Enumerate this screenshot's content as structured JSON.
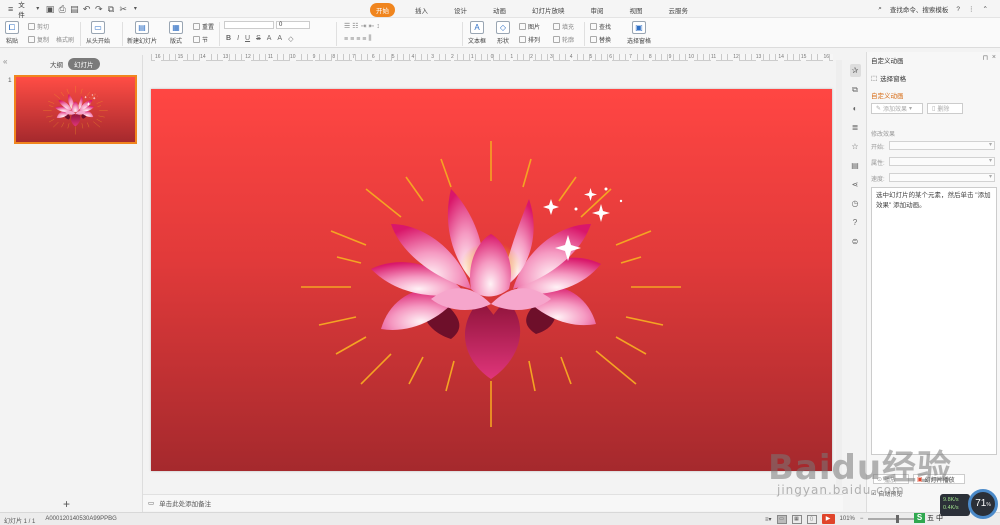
{
  "topbar": {
    "file_menu": "文件",
    "tabs": [
      "开始",
      "插入",
      "设计",
      "动画",
      "幻灯片放映",
      "审阅",
      "视图",
      "云服务"
    ],
    "active_tab": "开始",
    "search_text": "查找命令、搜索模板"
  },
  "ribbon": {
    "paste": "粘贴",
    "cut": "剪切",
    "copy": "复制",
    "format_painter": "格式刷",
    "from_start": "从头开始",
    "new_slide": "新建幻灯片",
    "layout": "版式",
    "reset": "重置",
    "section": "节",
    "font_size": "0",
    "text_box": "文本框",
    "shape": "形状",
    "picture": "图片",
    "fill": "填充",
    "arrange": "排列",
    "outline": "轮廓",
    "find": "查找",
    "replace": "替换",
    "select_pane": "选择窗格"
  },
  "left_panel": {
    "tab_outline": "大纲",
    "tab_slides": "幻灯片",
    "slide_number": "1",
    "add_icon": "+"
  },
  "ruler_ticks": [
    "16",
    "15",
    "14",
    "13",
    "12",
    "11",
    "10",
    "9",
    "8",
    "7",
    "6",
    "5",
    "4",
    "3",
    "2",
    "1",
    "0",
    "1",
    "2",
    "3",
    "4",
    "5",
    "6",
    "7",
    "8",
    "9",
    "10",
    "11",
    "12",
    "13",
    "14",
    "15",
    "16"
  ],
  "notes": {
    "placeholder": "单击此处添加备注"
  },
  "pane": {
    "title": "自定义动画",
    "select_pane": "选择窗格",
    "subtitle": "自定义动画",
    "add_effect": "添加效果",
    "delete": "删除",
    "modify_effect": "修改效果",
    "start_label": "开始:",
    "property_label": "属性:",
    "speed_label": "速度:",
    "hint": "选中幻灯片的某个元素，然后单击 \"添加效果\" 添加动画。",
    "play": "播放",
    "slideshow": "幻灯片播放",
    "autopreview": "自动预览"
  },
  "status": {
    "slide_info": "幻灯片 1 / 1",
    "doc_id": "A000120140530A99PPBG",
    "zoom": "101%"
  },
  "overlay": {
    "gauge_value": "71",
    "gauge_unit": "%",
    "net_up": "9.8K/s",
    "net_down": "0.4K/s",
    "ime_label": "五",
    "ime_extra": "中"
  },
  "watermark": {
    "brand": "Baidu经验",
    "url": "jingyan.baidu.com"
  },
  "colors": {
    "accent": "#f0851e",
    "slide_top": "#ff4643",
    "slide_bottom": "#a5292d",
    "ray": "#f4a423"
  }
}
